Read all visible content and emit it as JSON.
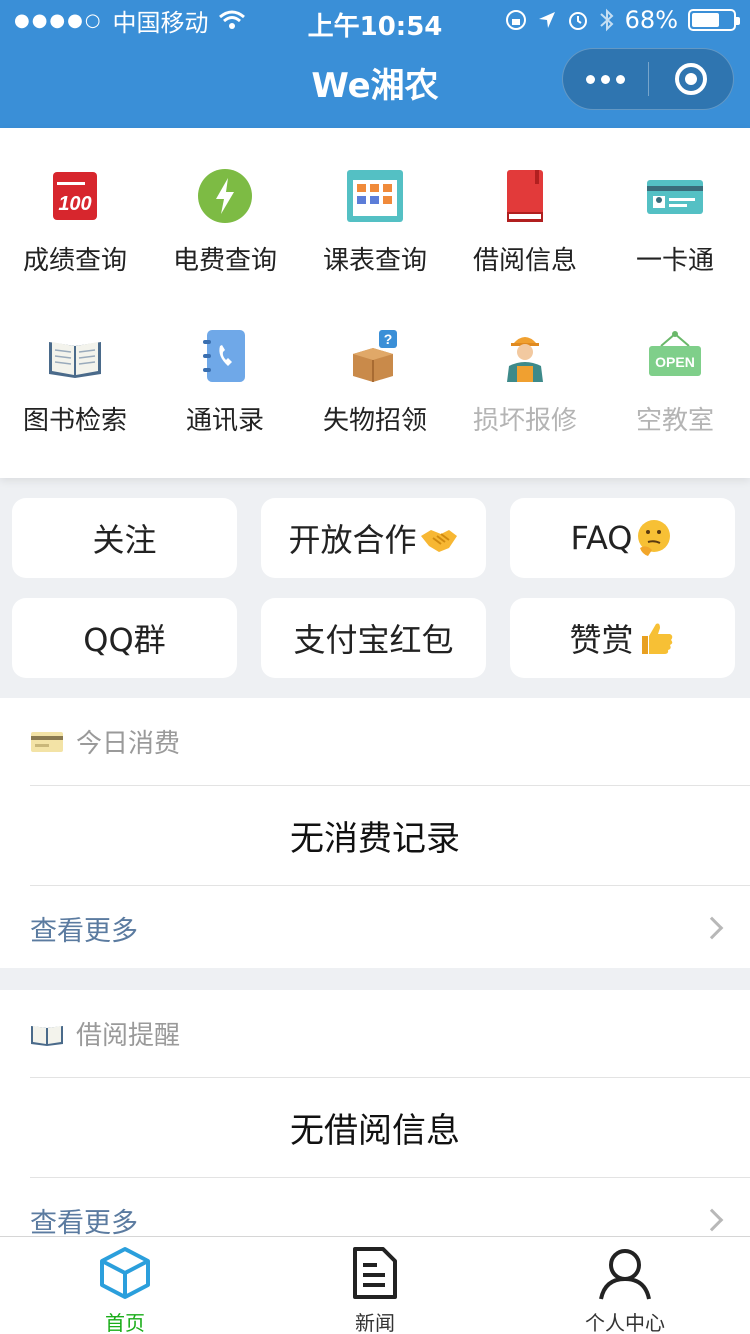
{
  "status_bar": {
    "signal_dots": "●●●●○",
    "carrier": "中国移动",
    "time": "上午10:54",
    "battery_percent": "68%",
    "battery_level": 0.68
  },
  "header": {
    "title": "We湘农",
    "colors": {
      "background": "#3a8fd7"
    }
  },
  "functions": [
    {
      "label": "成绩查询",
      "icon": "score-100-icon",
      "enabled": true
    },
    {
      "label": "电费查询",
      "icon": "lightning-icon",
      "enabled": true
    },
    {
      "label": "课表查询",
      "icon": "timetable-icon",
      "enabled": true
    },
    {
      "label": "借阅信息",
      "icon": "red-book-icon",
      "enabled": true
    },
    {
      "label": "一卡通",
      "icon": "id-card-icon",
      "enabled": true
    },
    {
      "label": "图书检索",
      "icon": "open-book-icon",
      "enabled": true
    },
    {
      "label": "通讯录",
      "icon": "phone-book-icon",
      "enabled": true
    },
    {
      "label": "失物招领",
      "icon": "question-box-icon",
      "enabled": true
    },
    {
      "label": "损坏报修",
      "icon": "repair-worker-icon",
      "enabled": false
    },
    {
      "label": "空教室",
      "icon": "open-sign-icon",
      "enabled": false
    }
  ],
  "buttons": [
    {
      "label": "关注",
      "emoji": ""
    },
    {
      "label": "开放合作",
      "emoji": "handshake-emoji"
    },
    {
      "label": "FAQ",
      "emoji": "thinking-face-emoji"
    },
    {
      "label": "QQ群",
      "emoji": ""
    },
    {
      "label": "支付宝红包",
      "emoji": ""
    },
    {
      "label": "赞赏",
      "emoji": "thumbs-up-emoji"
    }
  ],
  "cards": [
    {
      "title": "今日消费",
      "icon": "credit-card-icon",
      "empty_text": "无消费记录",
      "more_label": "查看更多"
    },
    {
      "title": "借阅提醒",
      "icon": "book-icon",
      "empty_text": "无借阅信息",
      "more_label": "查看更多"
    }
  ],
  "tabbar": [
    {
      "label": "首页",
      "icon": "cube-icon",
      "active": true,
      "active_color": "#1aad19"
    },
    {
      "label": "新闻",
      "icon": "document-icon",
      "active": false
    },
    {
      "label": "个人中心",
      "icon": "person-icon",
      "active": false
    }
  ]
}
